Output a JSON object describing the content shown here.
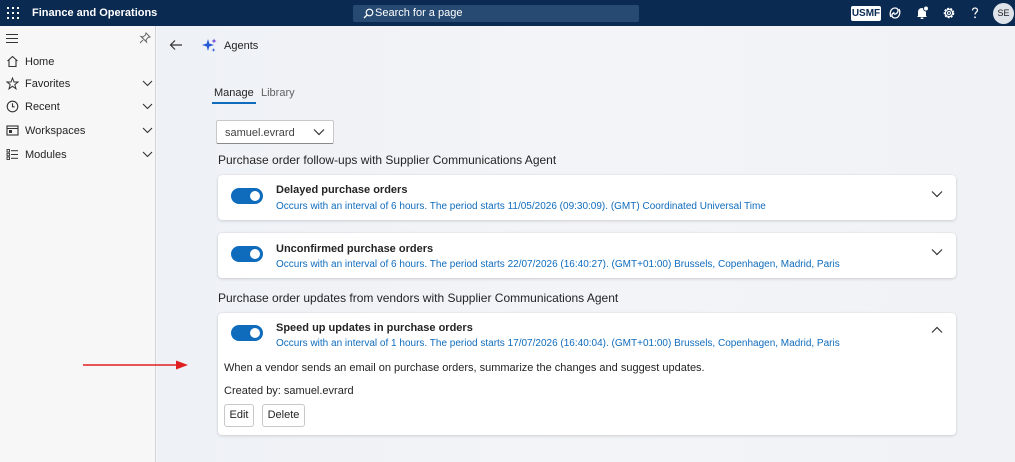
{
  "topbar": {
    "app_title": "Finance and Operations",
    "search_placeholder": "Search for a page",
    "company": "USMF",
    "avatar_initials": "SE"
  },
  "sidebar": {
    "items": [
      {
        "label": "Home",
        "icon": "home-icon"
      },
      {
        "label": "Favorites",
        "icon": "star-icon",
        "expandable": true
      },
      {
        "label": "Recent",
        "icon": "clock-icon",
        "expandable": true
      },
      {
        "label": "Workspaces",
        "icon": "workspaces-icon",
        "expandable": true
      },
      {
        "label": "Modules",
        "icon": "list-icon",
        "expandable": true
      }
    ]
  },
  "page": {
    "title": "Agents",
    "tabs": [
      {
        "label": "Manage",
        "selected": true
      },
      {
        "label": "Library",
        "selected": false
      }
    ],
    "user_filter": "samuel.evrard"
  },
  "sections": [
    {
      "heading": "Purchase order follow-ups with Supplier Communications Agent",
      "cards": [
        {
          "title": "Delayed purchase orders",
          "schedule": "Occurs with an interval of 6 hours. The period starts 11/05/2026 (09:30:09). (GMT) Coordinated Universal Time",
          "enabled": true,
          "expanded": false
        },
        {
          "title": "Unconfirmed purchase orders",
          "schedule": "Occurs with an interval of 6 hours. The period starts 22/07/2026 (16:40:27). (GMT+01:00) Brussels, Copenhagen, Madrid, Paris",
          "enabled": true,
          "expanded": false
        }
      ]
    },
    {
      "heading": "Purchase order updates from vendors with Supplier Communications Agent",
      "cards": [
        {
          "title": "Speed up updates in purchase orders",
          "schedule": "Occurs with an interval of 1 hours. The period starts 17/07/2026 (16:40:04). (GMT+01:00) Brussels, Copenhagen, Madrid, Paris",
          "enabled": true,
          "expanded": true,
          "description": "When a vendor sends an email on purchase orders, summarize the changes and suggest updates.",
          "created_by": "Created by: samuel.evrard",
          "buttons": {
            "edit": "Edit",
            "delete": "Delete"
          }
        }
      ]
    }
  ],
  "colors": {
    "topbar": "#0a2a52",
    "accent": "#0f6cbd",
    "annotation_arrow": "#e02020"
  }
}
